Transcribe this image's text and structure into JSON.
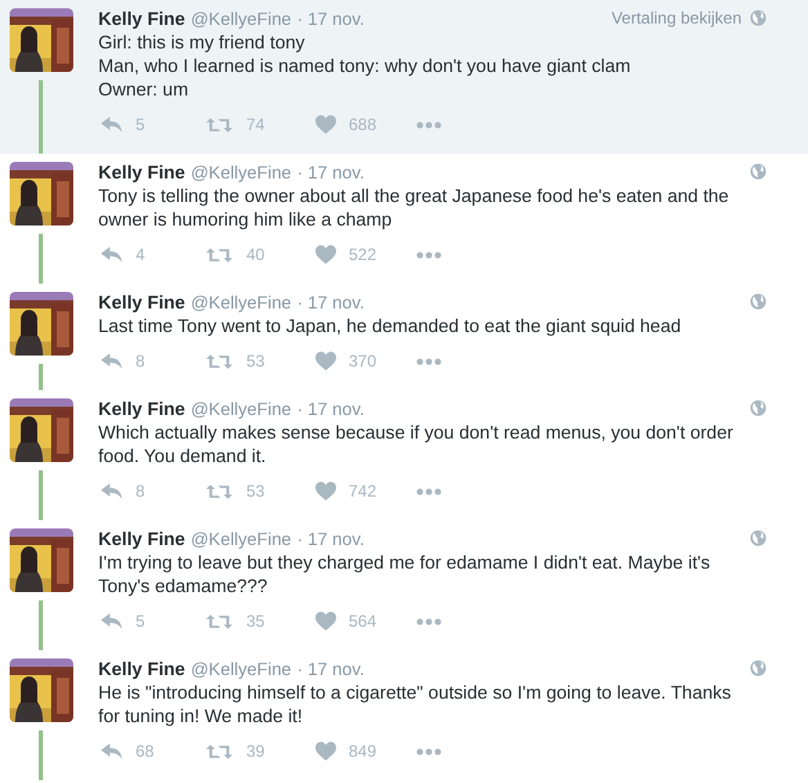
{
  "tweets": [
    {
      "highlighted": true,
      "name": "Kelly Fine",
      "handle": "@KellyeFine",
      "date": "· 17 nov.",
      "translate": "Vertaling bekijken",
      "text": "Girl: this is my friend tony\nMan, who I learned is named tony: why don't you have giant clam\nOwner: um",
      "replies": "5",
      "retweets": "74",
      "likes": "688"
    },
    {
      "highlighted": false,
      "name": "Kelly Fine",
      "handle": "@KellyeFine",
      "date": "· 17 nov.",
      "text": "Tony is telling the owner about all the great Japanese food he's eaten and the owner is humoring him like a champ",
      "replies": "4",
      "retweets": "40",
      "likes": "522"
    },
    {
      "highlighted": false,
      "name": "Kelly Fine",
      "handle": "@KellyeFine",
      "date": "· 17 nov.",
      "text": "Last time Tony went to Japan, he demanded to eat the giant squid head",
      "replies": "8",
      "retweets": "53",
      "likes": "370"
    },
    {
      "highlighted": false,
      "name": "Kelly Fine",
      "handle": "@KellyeFine",
      "date": "· 17 nov.",
      "text": "Which actually makes sense because if you don't read menus, you don't order food. You demand it.",
      "replies": "8",
      "retweets": "53",
      "likes": "742"
    },
    {
      "highlighted": false,
      "name": "Kelly Fine",
      "handle": "@KellyeFine",
      "date": "· 17 nov.",
      "text": "I'm trying to leave but they charged me for edamame I didn't eat. Maybe it's Tony's edamame???",
      "replies": "5",
      "retweets": "35",
      "likes": "564"
    },
    {
      "highlighted": false,
      "name": "Kelly Fine",
      "handle": "@KellyeFine",
      "date": "· 17 nov.",
      "text": "He is \"introducing himself to a cigarette\" outside so I'm going to leave. Thanks for tuning in! We made it!",
      "replies": "68",
      "retweets": "39",
      "likes": "849"
    }
  ]
}
